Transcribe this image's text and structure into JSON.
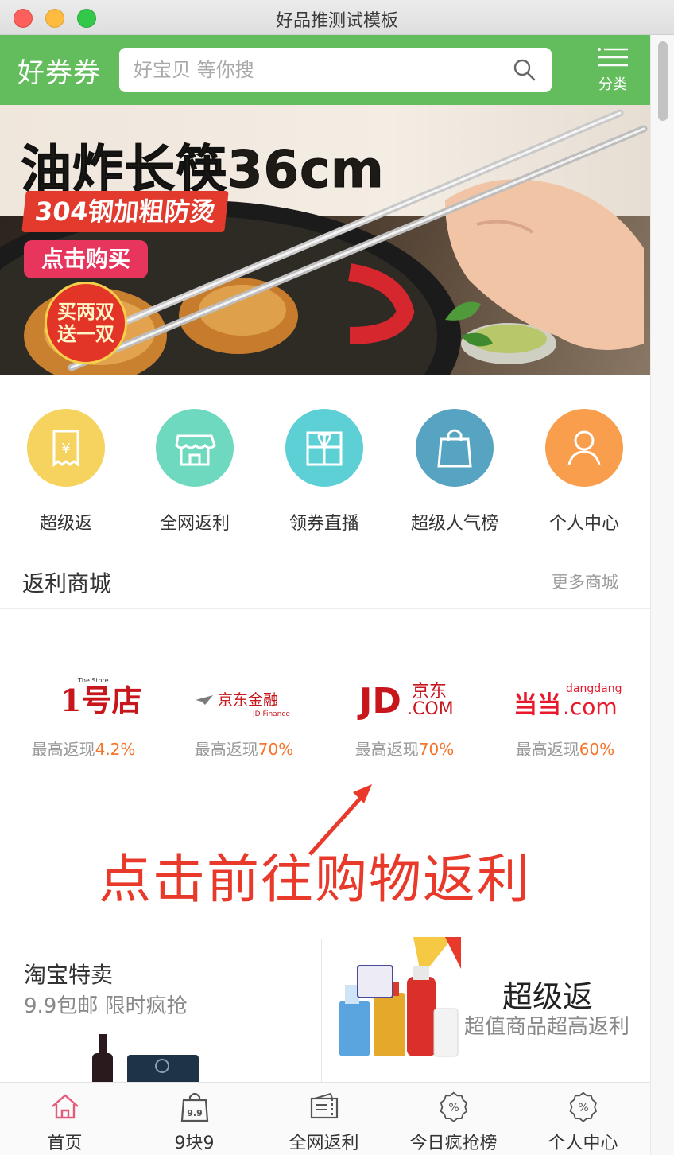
{
  "window": {
    "title": "好品推测试模板"
  },
  "header": {
    "logo": "好券券",
    "search_placeholder": "好宝贝 等你搜",
    "category_label": "分类",
    "bg_color": "#64bd5d"
  },
  "banner": {
    "title": "油炸长筷36cm",
    "tag1": "304钢加粗防烫",
    "tag2": "点击购买",
    "badge_line1": "买两双",
    "badge_line2": "送一双"
  },
  "categories": [
    {
      "label": "超级返",
      "icon": "receipt-yen-icon",
      "color": "#f5d35e"
    },
    {
      "label": "全网返利",
      "icon": "store-icon",
      "color": "#6fd9c0"
    },
    {
      "label": "领券直播",
      "icon": "gift-icon",
      "color": "#5dd0d6"
    },
    {
      "label": "超级人气榜",
      "icon": "shopping-bag-icon",
      "color": "#56a3c2"
    },
    {
      "label": "个人中心",
      "icon": "user-icon",
      "color": "#f99e4c"
    }
  ],
  "rebate_mall": {
    "title": "返利商城",
    "more": "更多商城",
    "malls": [
      {
        "name": "1号店",
        "rebate_prefix": "最高返现",
        "rebate_value": "4.2%"
      },
      {
        "name": "京东金融",
        "rebate_prefix": "最高返现",
        "rebate_value": "70%"
      },
      {
        "name": "京东",
        "rebate_prefix": "最高返现",
        "rebate_value": "70%"
      },
      {
        "name": "当当",
        "rebate_prefix": "最高返现",
        "rebate_value": "60%"
      }
    ],
    "logo_text": {
      "yhd_tiny": "The Store",
      "yhd_main": "1号店",
      "jdf_main": "京东金融",
      "jdf_sub": "JD Finance",
      "jd_left": "JD",
      "jd_cn": "京东",
      "jd_com": ".COM",
      "dd_cn": "当当",
      "dd_top": "dangdang",
      "dd_com": ".com"
    }
  },
  "annotation": "点击前往购物返利",
  "promos": {
    "left": {
      "title": "淘宝特卖",
      "subtitle": "9.9包邮 限时疯抢"
    },
    "right": {
      "title": "超级返",
      "subtitle": "超值商品超高返利"
    }
  },
  "tabbar": [
    {
      "label": "首页",
      "icon": "home-icon",
      "active": true
    },
    {
      "label": "9块9",
      "icon": "bag-99-icon",
      "active": false
    },
    {
      "label": "全网返利",
      "icon": "coupon-icon",
      "active": false
    },
    {
      "label": "今日疯抢榜",
      "icon": "percent-badge-icon",
      "active": false
    },
    {
      "label": "个人中心",
      "icon": "percent-badge-icon",
      "active": false
    }
  ]
}
